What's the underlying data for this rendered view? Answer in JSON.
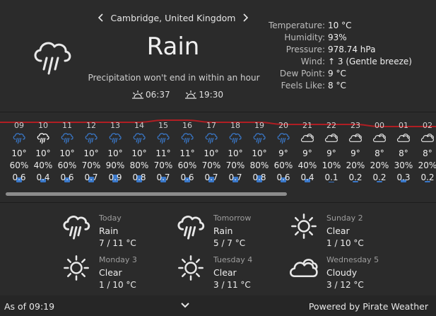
{
  "location": {
    "name": "Cambridge, United Kingdom",
    "prev_icon": "chevron-left-icon",
    "next_icon": "chevron-right-icon"
  },
  "current": {
    "icon": "rain-icon",
    "condition": "Rain",
    "summary": "Precipitation won't end in within an hour",
    "sunrise": "06:37",
    "sunset": "19:30",
    "sunrise_icon": "sunrise-icon",
    "sunset_icon": "sunset-icon"
  },
  "details": [
    {
      "label": "Temperature:",
      "value": "10 °C"
    },
    {
      "label": "Humidity:",
      "value": "93%"
    },
    {
      "label": "Pressure:",
      "value": "978.74 hPa"
    },
    {
      "label": "Wind:",
      "value": "↑ 3 (Gentle breeze)"
    },
    {
      "label": "Dew Point:",
      "value": "9 °C"
    },
    {
      "label": "Feels Like:",
      "value": "8 °C"
    }
  ],
  "hourly": [
    {
      "time": "09",
      "icon": "rain-icon",
      "temp": "10°",
      "pop": "60%",
      "amount": "0.6",
      "pop_value": 60,
      "amount_value": 0.6
    },
    {
      "time": "10",
      "icon": "rain-icon-white",
      "temp": "10°",
      "pop": "40%",
      "amount": "0.4",
      "pop_value": 40,
      "amount_value": 0.4
    },
    {
      "time": "11",
      "icon": "rain-icon",
      "temp": "10°",
      "pop": "60%",
      "amount": "0.6",
      "pop_value": 60,
      "amount_value": 0.6
    },
    {
      "time": "12",
      "icon": "rain-icon",
      "temp": "10°",
      "pop": "70%",
      "amount": "0.7",
      "pop_value": 70,
      "amount_value": 0.7
    },
    {
      "time": "13",
      "icon": "rain-icon",
      "temp": "10°",
      "pop": "90%",
      "amount": "0.9",
      "pop_value": 90,
      "amount_value": 0.9
    },
    {
      "time": "14",
      "icon": "rain-icon",
      "temp": "10°",
      "pop": "80%",
      "amount": "0.8",
      "pop_value": 80,
      "amount_value": 0.8
    },
    {
      "time": "15",
      "icon": "rain-icon",
      "temp": "11°",
      "pop": "70%",
      "amount": "0.7",
      "pop_value": 70,
      "amount_value": 0.7
    },
    {
      "time": "16",
      "icon": "rain-icon",
      "temp": "11°",
      "pop": "60%",
      "amount": "0.6",
      "pop_value": 60,
      "amount_value": 0.6
    },
    {
      "time": "17",
      "icon": "rain-icon",
      "temp": "10°",
      "pop": "70%",
      "amount": "0.7",
      "pop_value": 70,
      "amount_value": 0.7
    },
    {
      "time": "18",
      "icon": "rain-icon",
      "temp": "10°",
      "pop": "70%",
      "amount": "0.7",
      "pop_value": 70,
      "amount_value": 0.7
    },
    {
      "time": "19",
      "icon": "rain-icon",
      "temp": "10°",
      "pop": "80%",
      "amount": "0.8",
      "pop_value": 80,
      "amount_value": 0.8
    },
    {
      "time": "20",
      "icon": "rain-icon",
      "temp": "9°",
      "pop": "60%",
      "amount": "0.6",
      "pop_value": 60,
      "amount_value": 0.6
    },
    {
      "time": "21",
      "icon": "cloudy-icon",
      "temp": "9°",
      "pop": "40%",
      "amount": "0.4",
      "pop_value": 40,
      "amount_value": 0.4
    },
    {
      "time": "22",
      "icon": "cloudy-icon",
      "temp": "9°",
      "pop": "10%",
      "amount": "0.1",
      "pop_value": 10,
      "amount_value": 0.1
    },
    {
      "time": "23",
      "icon": "cloudy-icon",
      "temp": "9°",
      "pop": "20%",
      "amount": "0.2",
      "pop_value": 20,
      "amount_value": 0.2
    },
    {
      "time": "00",
      "icon": "cloudy-icon",
      "temp": "8°",
      "pop": "20%",
      "amount": "0.2",
      "pop_value": 20,
      "amount_value": 0.2
    },
    {
      "time": "01",
      "icon": "cloudy-icon",
      "temp": "8°",
      "pop": "30%",
      "amount": "0.3",
      "pop_value": 30,
      "amount_value": 0.3
    },
    {
      "time": "02",
      "icon": "cloudy-icon",
      "temp": "8°",
      "pop": "20%",
      "amount": "0.2",
      "pop_value": 20,
      "amount_value": 0.2
    }
  ],
  "daily": [
    {
      "name": "Today",
      "icon": "rain-icon",
      "condition": "Rain",
      "temps": "7 / 11 °C"
    },
    {
      "name": "Tomorrow",
      "icon": "rain-icon",
      "condition": "Rain",
      "temps": "5 / 7 °C"
    },
    {
      "name": "Sunday 2",
      "icon": "sun-icon",
      "condition": "Clear",
      "temps": "1 / 10 °C"
    },
    {
      "name": "Monday 3",
      "icon": "sun-icon",
      "condition": "Clear",
      "temps": "1 / 10 °C"
    },
    {
      "name": "Tuesday 4",
      "icon": "sun-icon",
      "condition": "Clear",
      "temps": "3 / 11 °C"
    },
    {
      "name": "Wednesday 5",
      "icon": "cloudy-icon",
      "condition": "Cloudy",
      "temps": "3 / 12 °C"
    }
  ],
  "footer": {
    "as_of": "As of 09:19",
    "expand_icon": "chevron-down-icon",
    "powered_by": "Powered by Pirate Weather"
  },
  "colors": {
    "background": "#2b2b2b",
    "accent_blue": "#3a78c9",
    "temp_line": "#b01e23",
    "text": "#e8e8e8"
  },
  "scroll_position": 0
}
